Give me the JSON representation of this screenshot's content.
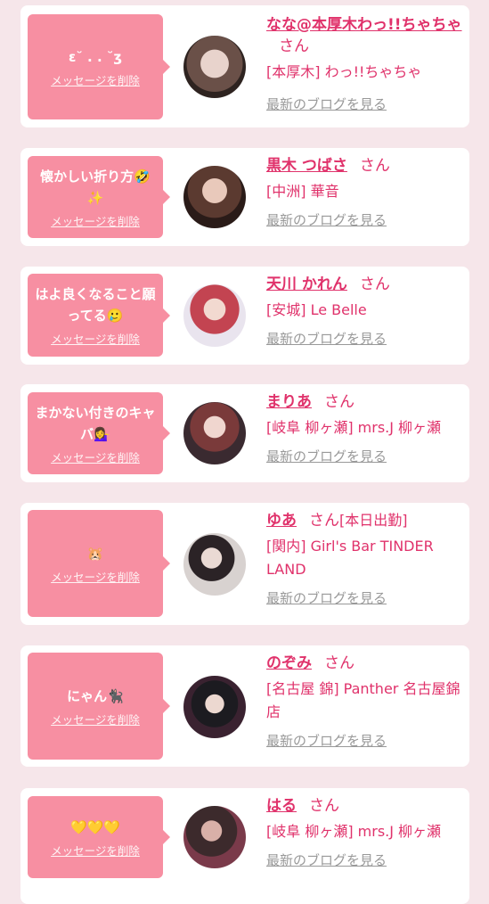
{
  "colors": {
    "accent": "#e0326b",
    "bubble": "#f78fa2",
    "background": "#f6e6ea"
  },
  "labels": {
    "delete": "メッセージを削除",
    "blog": "最新のブログを見る",
    "san": "さん"
  },
  "cards": [
    {
      "message": "ɛ˘ . . ˘ʒ",
      "name": "なな@本厚木わっ!!ちゃちゃ",
      "extra": "",
      "shop": "[本厚木] わっ!!ちゃちゃ"
    },
    {
      "message": "懐かしい折り方🤣✨",
      "name": "黒木 つばさ",
      "extra": "",
      "shop": "[中洲] 華音"
    },
    {
      "message": "はよ良くなること願ってる🥲",
      "name": "天川 かれん",
      "extra": "",
      "shop": "[安城] Le Belle"
    },
    {
      "message": "まかない付きのキャバ💁‍♀️",
      "name": "まりあ",
      "extra": "",
      "shop": "[岐阜 柳ヶ瀬] mrs.J 柳ヶ瀬"
    },
    {
      "message": "🐹",
      "name": "ゆあ",
      "extra": "[本日出勤]",
      "shop": "[関内] Girl's Bar TINDER LAND"
    },
    {
      "message": "にゃん🐈‍⬛",
      "name": "のぞみ",
      "extra": "",
      "shop": "[名古屋 錦] Panther 名古屋錦店"
    },
    {
      "message": "💛💛💛",
      "name": "はる",
      "extra": "",
      "shop": "[岐阜 柳ヶ瀬] mrs.J 柳ヶ瀬"
    }
  ]
}
